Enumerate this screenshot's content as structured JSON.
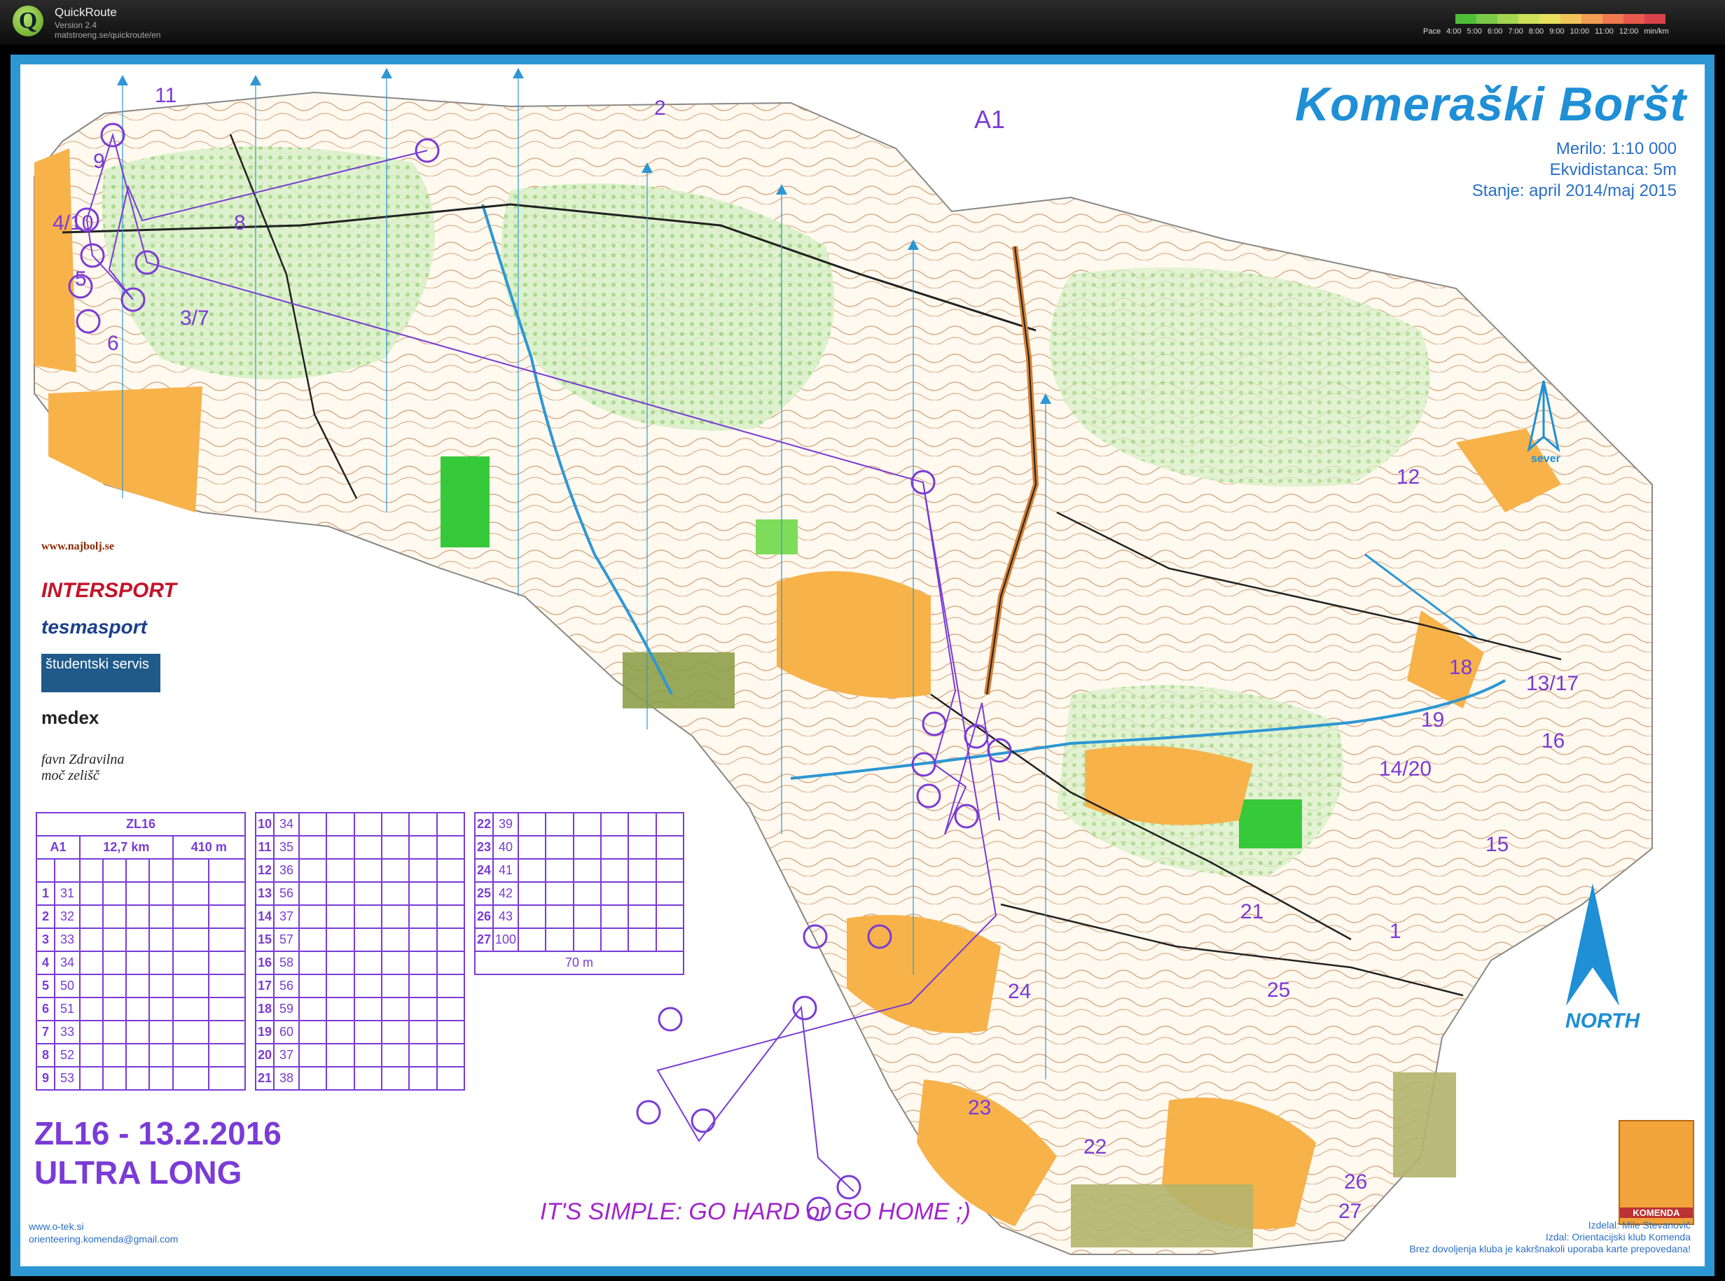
{
  "app": {
    "name": "QuickRoute",
    "version": "Version 2.4",
    "url": "matstroeng.se/quickroute/en",
    "pace_label": "Pace",
    "pace_ticks": [
      "4:00",
      "5:00",
      "6:00",
      "7:00",
      "8:00",
      "9:00",
      "10:00",
      "11:00",
      "12:00",
      "min/km"
    ],
    "pace_colors": [
      "#4fbf3a",
      "#7ccb48",
      "#a6d650",
      "#cde05a",
      "#e6e05e",
      "#f0c45a",
      "#f29e54",
      "#ef7a4e",
      "#e85a4c",
      "#d9444a"
    ]
  },
  "map": {
    "title": "Komeraški Boršt",
    "scale": "Merilo: 1:10 000",
    "contour": "Ekvidistanca: 5m",
    "status": "Stanje: april 2014/maj 2015",
    "course": "A1",
    "north_label": "NORTH",
    "north_small_label": "sever",
    "event_line1": "ZL16 - 13.2.2016",
    "event_line2": "ULTRA LONG",
    "slogan": "IT'S SIMPLE: GO HARD or GO HOME ;)",
    "website": "www.o-tek.si",
    "email": "orienteering.komenda@gmail.com",
    "credit_drawn": "Izdelal: Mile Stevanovič",
    "credit_published": "Izdal: Orientacijski klub Komenda",
    "credit_notice": "Brez dovoljenja kluba je kakršnakoli uporaba karte prepovedana!",
    "club_logo_text": "KOMENDA",
    "sponsors": [
      "www.najbolj.se",
      "INTERSPORT",
      "tesmasport",
      "študentski servis",
      "medex",
      "favn Zdravilna moč zelišč"
    ],
    "controls": [
      {
        "label": "11"
      },
      {
        "label": "9"
      },
      {
        "label": "4/10"
      },
      {
        "label": "8"
      },
      {
        "label": "5"
      },
      {
        "label": "3/7"
      },
      {
        "label": "6"
      },
      {
        "label": "2"
      },
      {
        "label": "12"
      },
      {
        "label": "18"
      },
      {
        "label": "13/17"
      },
      {
        "label": "19"
      },
      {
        "label": "16"
      },
      {
        "label": "14/20"
      },
      {
        "label": "15"
      },
      {
        "label": "21"
      },
      {
        "label": "1"
      },
      {
        "label": "24"
      },
      {
        "label": "25"
      },
      {
        "label": "23"
      },
      {
        "label": "22"
      },
      {
        "label": "26"
      },
      {
        "label": "27"
      }
    ]
  },
  "descriptions": {
    "header_event": "ZL16",
    "header_course": "A1",
    "header_length": "12,7 km",
    "header_climb": "410 m",
    "finish_distance": "70 m",
    "col1": [
      [
        "1",
        "31"
      ],
      [
        "2",
        "32"
      ],
      [
        "3",
        "33"
      ],
      [
        "4",
        "34"
      ],
      [
        "5",
        "50"
      ],
      [
        "6",
        "51"
      ],
      [
        "7",
        "33"
      ],
      [
        "8",
        "52"
      ],
      [
        "9",
        "53"
      ]
    ],
    "col2": [
      [
        "10",
        "34"
      ],
      [
        "11",
        "35"
      ],
      [
        "12",
        "36"
      ],
      [
        "13",
        "56"
      ],
      [
        "14",
        "37"
      ],
      [
        "15",
        "57"
      ],
      [
        "16",
        "58"
      ],
      [
        "17",
        "56"
      ],
      [
        "18",
        "59"
      ],
      [
        "19",
        "60"
      ],
      [
        "20",
        "37"
      ],
      [
        "21",
        "38"
      ]
    ],
    "col3": [
      [
        "22",
        "39"
      ],
      [
        "23",
        "40"
      ],
      [
        "24",
        "41"
      ],
      [
        "25",
        "42"
      ],
      [
        "26",
        "43"
      ],
      [
        "27",
        "100"
      ]
    ]
  }
}
